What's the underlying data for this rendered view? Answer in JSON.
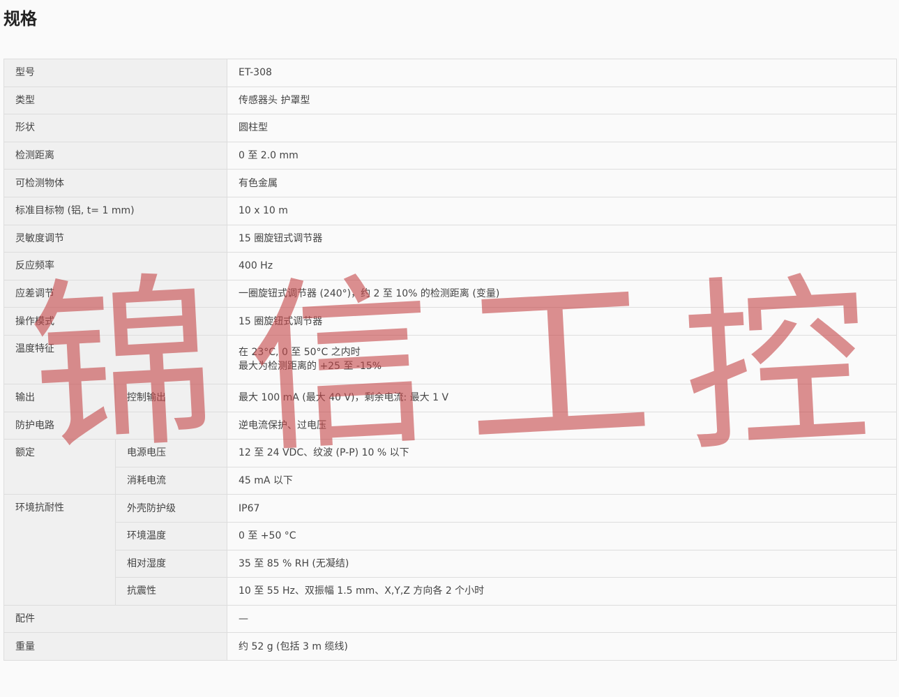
{
  "page": {
    "title": "规格"
  },
  "rows": {
    "model": {
      "label": "型号",
      "value": "ET-308"
    },
    "type": {
      "label": "类型",
      "value": "传感器头 护罩型"
    },
    "shape": {
      "label": "形状",
      "value": "圆柱型"
    },
    "distance": {
      "label": "检测距离",
      "value": "0 至 2.0 mm"
    },
    "objects": {
      "label": "可检测物体",
      "value": "有色金属"
    },
    "target": {
      "label": "标准目标物 (铝, t= 1 mm)",
      "value": "10 x 10 m"
    },
    "sensitivity": {
      "label": "灵敏度调节",
      "value": "15 圈旋钮式调节器"
    },
    "frequency": {
      "label": "反应频率",
      "value": "400 Hz"
    },
    "hysteresis": {
      "label": "应差调节",
      "value": "一圈旋钮式调节器 (240°)，约 2 至 10% 的检测距离 (变量)"
    },
    "operation": {
      "label": "操作模式",
      "value": "15 圈旋钮式调节器"
    },
    "temperature": {
      "label": "温度特征",
      "value_line1": "在 23°C, 0 至 50°C 之内时",
      "value_line2": "最大为检测距离的 +25 至 -15%"
    },
    "output": {
      "label": "输出",
      "sublabel": "控制输出",
      "value": "最大 100 mA (最大 40 V)，剩余电流: 最大 1 V"
    },
    "protection": {
      "label": "防护电路",
      "value": "逆电流保护、过电压"
    },
    "rating": {
      "label": "额定",
      "voltage": {
        "label": "电源电压",
        "value": "12 至 24 VDC、纹波 (P-P) 10 % 以下"
      },
      "current": {
        "label": "消耗电流",
        "value": "45 mA 以下"
      }
    },
    "environment": {
      "label": "环境抗耐性",
      "enclosure": {
        "label": "外壳防护级",
        "value": "IP67"
      },
      "ambient_temp": {
        "label": "环境温度",
        "value": "0 至 +50 °C"
      },
      "humidity": {
        "label": "相对湿度",
        "value": "35 至 85 % RH (无凝结)"
      },
      "vibration": {
        "label": "抗震性",
        "value": "10 至 55 Hz、双振幅 1.5 mm、X,Y,Z 方向各 2 个小时"
      }
    },
    "accessories": {
      "label": "配件",
      "value": "—"
    },
    "weight": {
      "label": "重量",
      "value": "约 52 g (包括 3 m 缆线)"
    }
  },
  "watermark": {
    "chars": [
      "锦",
      "信",
      "工",
      "控"
    ],
    "color": "#c44648"
  }
}
